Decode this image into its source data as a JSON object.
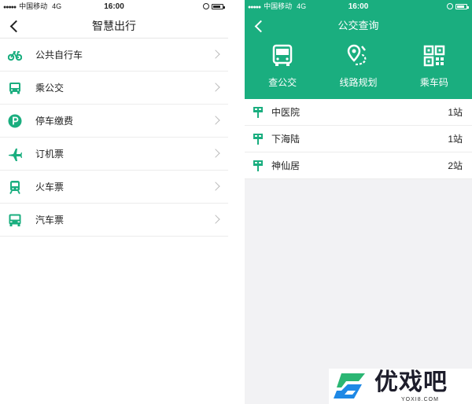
{
  "colors": {
    "accent": "#1aae7f",
    "title_text": "#222222",
    "divider": "#ececec",
    "panel_bg": "#f2f2f4"
  },
  "left_screen": {
    "statusbar": {
      "signal": "●●●●●",
      "carrier": "中国移动",
      "network": "4G",
      "time": "16:00"
    },
    "navbar": {
      "back_icon": "chevron-left-icon",
      "title": "智慧出行"
    },
    "menu": [
      {
        "icon": "bicycle-icon",
        "label": "公共自行车"
      },
      {
        "icon": "bus-icon",
        "label": "乘公交"
      },
      {
        "icon": "parking-icon",
        "label": "停车缴费"
      },
      {
        "icon": "airplane-icon",
        "label": "订机票"
      },
      {
        "icon": "train-icon",
        "label": "火车票"
      },
      {
        "icon": "coach-icon",
        "label": "汽车票"
      }
    ]
  },
  "right_screen": {
    "statusbar": {
      "signal": "●●●●●",
      "carrier": "中国移动",
      "network": "4G",
      "time": "16:00"
    },
    "navbar": {
      "back_icon": "chevron-left-icon",
      "title": "公交查询"
    },
    "actions": [
      {
        "icon": "bus-front-icon",
        "label": "查公交"
      },
      {
        "icon": "route-pin-icon",
        "label": "线路规划"
      },
      {
        "icon": "qr-code-icon",
        "label": "乘车码"
      }
    ],
    "stations": [
      {
        "icon": "bus-stop-icon",
        "name": "中医院",
        "stops": "1站"
      },
      {
        "icon": "bus-stop-icon",
        "name": "下海陆",
        "stops": "1站"
      },
      {
        "icon": "bus-stop-icon",
        "name": "神仙居",
        "stops": "2站"
      }
    ]
  },
  "watermark": {
    "brand": "优戏吧",
    "url": "YOXI8.COM"
  }
}
